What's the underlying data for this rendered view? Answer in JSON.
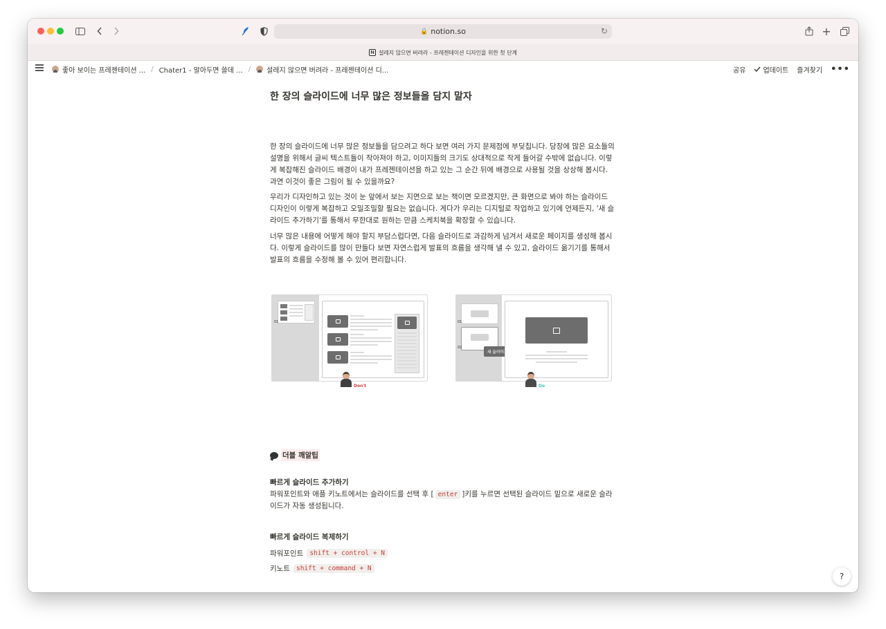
{
  "browser": {
    "url": "notion.so",
    "tab_title": "설레지 않으면 버려라 - 프레젠테이션 디자인을 위한 첫 단계"
  },
  "topbar": {
    "breadcrumbs": [
      "좋아 보이는 프레젠테이션 ...",
      "Chater1 - 알아두면 쓸데 ...",
      "설레지 않으면 버려라 - 프레젠테이션 디..."
    ],
    "separator": "/",
    "share": "공유",
    "updates": "업데이트",
    "favorites": "즐겨찾기",
    "more": "•••"
  },
  "content": {
    "heading": "한 장의 슬라이드에 너무 많은 정보들을 담지 말자",
    "paragraphs": [
      "한 장의 슬라이드에 너무 많은 정보들을 담으려고 하다 보면 여러 가지 문제점에 부딪칩니다. 당장에 많은 요소들의 설명을 위해서 글씨 텍스트들이 작아져야 하고, 이미지들의 크기도 상대적으로 작게 들어갈 수밖에 없습니다. 이렇게 복잡해진 슬라이드 배경이 내가 프레젠테이션을 하고 있는 그 순간 뒤에 배경으로 사용될 것을 상상해 봅시다. 과연 이것이 좋은 그림이 될 수 있을까요?",
      "우리가 디자인하고 있는 것이 눈 앞에서 보는 지면으로 보는 책이면 모르겠지만, 큰 화면으로 봐야 하는 슬라이드 디자인이 이렇게 복잡하고 오밀조밀할 필요는 없습니다. 게다가 우리는 디지털로 작업하고 있기에 언제든지, '새 슬라이드 추가하기'를 통해서 무한대로 원하는 만큼 스케치북을 확장할 수 있습니다.",
      "너무 많은 내용에 어떻게 해야 할지 부담스럽다면, 다음 슬라이드로 과감하게 넘겨서 새로운 페이지를 생성해 봅시다. 이렇게 슬라이드를 많이 만들다 보면 자연스럽게 발표의 흐름을 생각해 낼 수 있고, 슬라이드 옮기기를 통해서 발표의 흐름을 수정해 볼 수 있어 편리합니다."
    ],
    "illustration": {
      "left_number": "01",
      "right_numbers": [
        "01",
        "02"
      ],
      "tooltip": "새 슬라이드",
      "dont_label": "Don't",
      "do_label": "Do",
      "dont_color": "#d0413a",
      "do_color": "#37c6b8"
    },
    "callout": "더블 깨알팁",
    "tip1": {
      "title": "빠르게 슬라이드 추가하기",
      "text_before": "파워포인트와 애플 키노트에서는 슬라이드를 선택 후 [",
      "code": "enter",
      "text_after": "]키를 누르면 선택된 슬라이드 밑으로 새로운 슬라이드가 자동 생성됩니다."
    },
    "tip2": {
      "title": "빠르게 슬라이드 복제하기",
      "rows": [
        {
          "label": "파워포인트",
          "code": "shift + control + N"
        },
        {
          "label": "키노트",
          "code": "shift + command + N"
        }
      ]
    }
  },
  "help": "?"
}
